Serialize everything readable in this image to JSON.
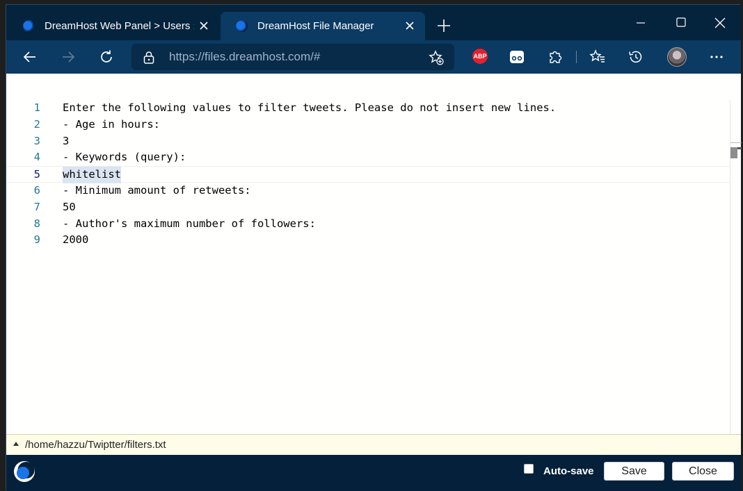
{
  "browser": {
    "tabs": [
      {
        "title": "DreamHost Web Panel > Users :",
        "active": false
      },
      {
        "title": "DreamHost File Manager",
        "active": true
      }
    ],
    "address_bar": {
      "url_host": "https://files.dreamhost.com/",
      "url_hash": "#"
    },
    "colors": {
      "chrome_dark": "#04233d",
      "chrome_toolbar": "#0b3a63",
      "abp": "#e5202e"
    }
  },
  "editor": {
    "lines": [
      {
        "number": "1",
        "text": "Enter the following values to filter tweets. Please do not insert new lines."
      },
      {
        "number": "2",
        "text": "- Age in hours:"
      },
      {
        "number": "3",
        "text": "3"
      },
      {
        "number": "4",
        "text": "- Keywords (query):"
      },
      {
        "number": "5",
        "text": "whitelist"
      },
      {
        "number": "6",
        "text": "- Minimum amount of retweets:"
      },
      {
        "number": "7",
        "text": "50"
      },
      {
        "number": "8",
        "text": "- Author's maximum number of followers:"
      },
      {
        "number": "9",
        "text": "2000"
      }
    ],
    "current_line": "5",
    "colors": {
      "line_number": "#237893",
      "selection": "#dbe5f1"
    }
  },
  "status": {
    "file_path": "/home/hazzu/Twiptter/filters.txt"
  },
  "footer": {
    "autosave_label": "Auto-save",
    "autosave_checked": false,
    "save_label": "Save",
    "close_label": "Close"
  }
}
